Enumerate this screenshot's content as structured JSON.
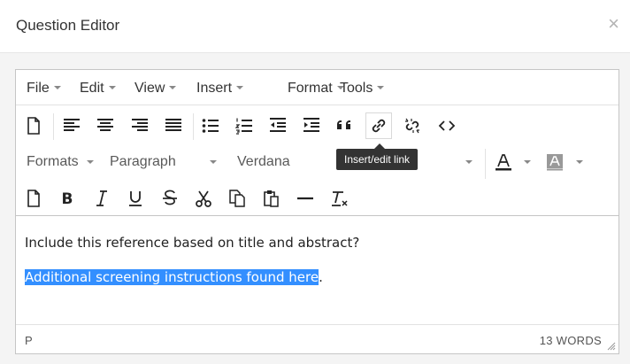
{
  "dialog": {
    "title": "Question Editor",
    "close_symbol": "×"
  },
  "menubar": [
    {
      "label": "File"
    },
    {
      "label": "Edit"
    },
    {
      "label": "View"
    },
    {
      "label": "Insert"
    },
    {
      "label": "Format"
    },
    {
      "label": "Tools"
    }
  ],
  "toolbar": {
    "format_dropdown": "Formats",
    "block_dropdown": "Paragraph",
    "font_dropdown": "Verdana"
  },
  "tooltip": {
    "text": "Insert/edit link"
  },
  "content": {
    "paragraph1": "Include this reference based on title and abstract?",
    "paragraph2_selected": "Additional screening instructions found here",
    "paragraph2_tail": "."
  },
  "statusbar": {
    "path": "P",
    "word_count": "13 WORDS"
  },
  "colors": {
    "selection": "#338fff",
    "tooltip_bg": "#333333",
    "border": "#c5c5c5"
  }
}
